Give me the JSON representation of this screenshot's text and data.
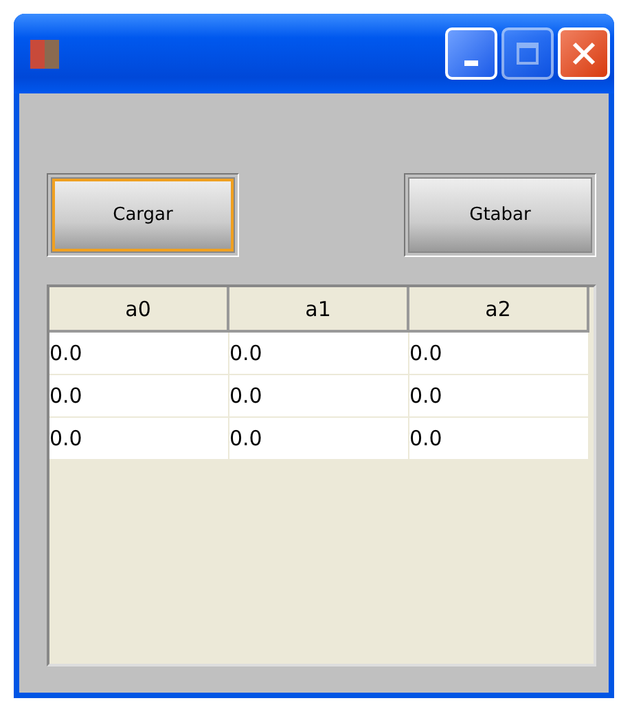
{
  "window": {
    "controls": [
      {
        "kind": "minimize",
        "disabled": false
      },
      {
        "kind": "maximize",
        "disabled": true
      },
      {
        "kind": "close",
        "disabled": false
      }
    ]
  },
  "buttons": [
    {
      "label": "Cargar",
      "focused": true
    },
    {
      "label": "Gtabar",
      "focused": false
    }
  ],
  "table": {
    "columns": [
      "a0",
      "a1",
      "a2"
    ],
    "rows": [
      [
        "0.0",
        "0.0",
        "0.0"
      ],
      [
        "0.0",
        "0.0",
        "0.0"
      ],
      [
        "0.0",
        "0.0",
        "0.0"
      ]
    ]
  }
}
